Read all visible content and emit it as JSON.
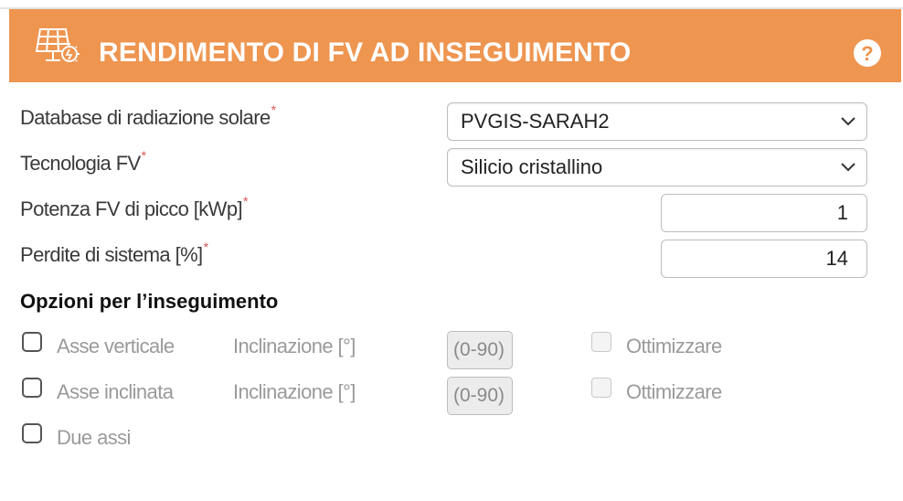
{
  "header": {
    "title": "RENDIMENTO DI FV AD INSEGUIMENTO",
    "help_label": "?",
    "logo_icon": "solar-panel-icon",
    "background_color": "#ee9550"
  },
  "form": {
    "required_marker": "*",
    "radiation_db": {
      "label": "Database di radiazione solare",
      "value": "PVGIS-SARAH2"
    },
    "pv_technology": {
      "label": "Tecnologia FV",
      "value": "Silicio cristallino"
    },
    "peak_power": {
      "label": "Potenza FV di picco [kWp]",
      "value": "1"
    },
    "system_loss": {
      "label": "Perdite di sistema [%]",
      "value": "14"
    }
  },
  "tracking": {
    "section_title": "Opzioni per l’inseguimento",
    "options": [
      {
        "label": "Asse verticale",
        "slope_label": "Inclinazione [°]",
        "slope_placeholder": "(0-90)",
        "optimize_label": "Ottimizzare"
      },
      {
        "label": "Asse inclinata",
        "slope_label": "Inclinazione [°]",
        "slope_placeholder": "(0-90)",
        "optimize_label": "Ottimizzare"
      },
      {
        "label": "Due assi"
      }
    ]
  }
}
